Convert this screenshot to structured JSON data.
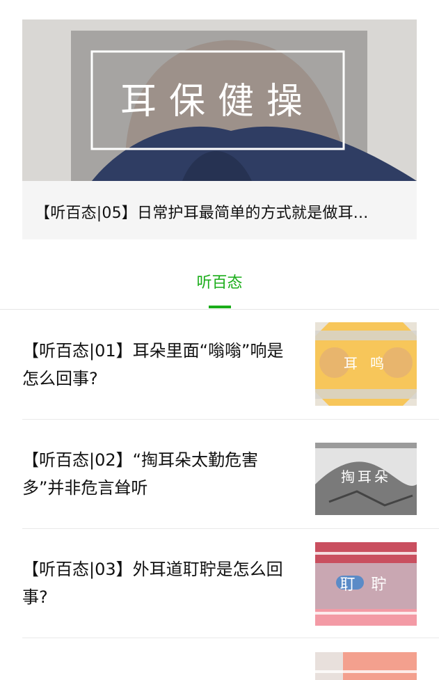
{
  "featured": {
    "image_caption": "耳保健操",
    "title": "【听百态|05】日常护耳最简单的方式就是做耳..."
  },
  "tab": {
    "label": "听百态",
    "accent_color": "#1aad19"
  },
  "articles": [
    {
      "title": "【听百态|01】耳朵里面“嗡嗡”响是怎么回事?",
      "thumb_caption": "耳 鸣"
    },
    {
      "title": "【听百态|02】“掏耳朵太勤危害多”并非危言耸听",
      "thumb_caption": "掏耳朵"
    },
    {
      "title": "【听百态|03】外耳道耵聍是怎么回事?",
      "thumb_caption": "耵 聍"
    }
  ]
}
